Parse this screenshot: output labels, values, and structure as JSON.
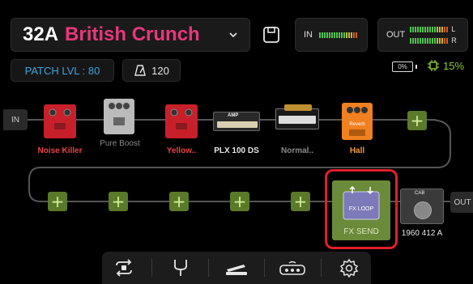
{
  "header": {
    "patch_number": "32A",
    "patch_name": "British Crunch",
    "input_meter_label": "IN",
    "output_meter_label": "OUT",
    "out_left": "L",
    "out_right": "R"
  },
  "status": {
    "patch_level": "PATCH LVL : 80",
    "tempo": "120",
    "battery": "0%",
    "cpu": "15%"
  },
  "chain": {
    "in_label": "IN",
    "out_label": "OUT",
    "pedals": [
      {
        "label": "Noise Killer"
      },
      {
        "label": "Pure Boost"
      },
      {
        "label": "Yellow.."
      },
      {
        "label": "PLX 100 DS"
      },
      {
        "label": "Normal.."
      },
      {
        "label": "Hall"
      }
    ],
    "fx_loop": {
      "label": "FX SEND",
      "face_text": "FX LOOP"
    },
    "cab": {
      "label": "1960 412 A",
      "badge": "CAB"
    },
    "amp_badge": "AMP",
    "reverb_text": "Reverb"
  },
  "colors": {
    "patch_name": "#e8377a",
    "patch_level": "#3aa6e0",
    "cpu": "#8ccd2e",
    "add_button": "#5a7a2a",
    "highlight": "#e0202a"
  },
  "toolbar": {
    "icons": [
      "loop-icon",
      "tuner-icon",
      "expression-pedal-icon",
      "footswitch-icon",
      "settings-icon"
    ]
  }
}
